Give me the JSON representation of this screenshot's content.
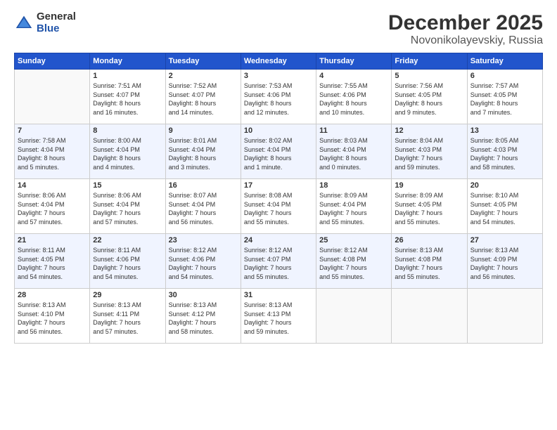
{
  "logo": {
    "general": "General",
    "blue": "Blue"
  },
  "header": {
    "month": "December 2025",
    "location": "Novonikolayevskiy, Russia"
  },
  "weekdays": [
    "Sunday",
    "Monday",
    "Tuesday",
    "Wednesday",
    "Thursday",
    "Friday",
    "Saturday"
  ],
  "weeks": [
    [
      {
        "day": "",
        "info": ""
      },
      {
        "day": "1",
        "info": "Sunrise: 7:51 AM\nSunset: 4:07 PM\nDaylight: 8 hours\nand 16 minutes."
      },
      {
        "day": "2",
        "info": "Sunrise: 7:52 AM\nSunset: 4:07 PM\nDaylight: 8 hours\nand 14 minutes."
      },
      {
        "day": "3",
        "info": "Sunrise: 7:53 AM\nSunset: 4:06 PM\nDaylight: 8 hours\nand 12 minutes."
      },
      {
        "day": "4",
        "info": "Sunrise: 7:55 AM\nSunset: 4:06 PM\nDaylight: 8 hours\nand 10 minutes."
      },
      {
        "day": "5",
        "info": "Sunrise: 7:56 AM\nSunset: 4:05 PM\nDaylight: 8 hours\nand 9 minutes."
      },
      {
        "day": "6",
        "info": "Sunrise: 7:57 AM\nSunset: 4:05 PM\nDaylight: 8 hours\nand 7 minutes."
      }
    ],
    [
      {
        "day": "7",
        "info": "Sunrise: 7:58 AM\nSunset: 4:04 PM\nDaylight: 8 hours\nand 5 minutes."
      },
      {
        "day": "8",
        "info": "Sunrise: 8:00 AM\nSunset: 4:04 PM\nDaylight: 8 hours\nand 4 minutes."
      },
      {
        "day": "9",
        "info": "Sunrise: 8:01 AM\nSunset: 4:04 PM\nDaylight: 8 hours\nand 3 minutes."
      },
      {
        "day": "10",
        "info": "Sunrise: 8:02 AM\nSunset: 4:04 PM\nDaylight: 8 hours\nand 1 minute."
      },
      {
        "day": "11",
        "info": "Sunrise: 8:03 AM\nSunset: 4:04 PM\nDaylight: 8 hours\nand 0 minutes."
      },
      {
        "day": "12",
        "info": "Sunrise: 8:04 AM\nSunset: 4:03 PM\nDaylight: 7 hours\nand 59 minutes."
      },
      {
        "day": "13",
        "info": "Sunrise: 8:05 AM\nSunset: 4:03 PM\nDaylight: 7 hours\nand 58 minutes."
      }
    ],
    [
      {
        "day": "14",
        "info": "Sunrise: 8:06 AM\nSunset: 4:04 PM\nDaylight: 7 hours\nand 57 minutes."
      },
      {
        "day": "15",
        "info": "Sunrise: 8:06 AM\nSunset: 4:04 PM\nDaylight: 7 hours\nand 57 minutes."
      },
      {
        "day": "16",
        "info": "Sunrise: 8:07 AM\nSunset: 4:04 PM\nDaylight: 7 hours\nand 56 minutes."
      },
      {
        "day": "17",
        "info": "Sunrise: 8:08 AM\nSunset: 4:04 PM\nDaylight: 7 hours\nand 55 minutes."
      },
      {
        "day": "18",
        "info": "Sunrise: 8:09 AM\nSunset: 4:04 PM\nDaylight: 7 hours\nand 55 minutes."
      },
      {
        "day": "19",
        "info": "Sunrise: 8:09 AM\nSunset: 4:05 PM\nDaylight: 7 hours\nand 55 minutes."
      },
      {
        "day": "20",
        "info": "Sunrise: 8:10 AM\nSunset: 4:05 PM\nDaylight: 7 hours\nand 54 minutes."
      }
    ],
    [
      {
        "day": "21",
        "info": "Sunrise: 8:11 AM\nSunset: 4:05 PM\nDaylight: 7 hours\nand 54 minutes."
      },
      {
        "day": "22",
        "info": "Sunrise: 8:11 AM\nSunset: 4:06 PM\nDaylight: 7 hours\nand 54 minutes."
      },
      {
        "day": "23",
        "info": "Sunrise: 8:12 AM\nSunset: 4:06 PM\nDaylight: 7 hours\nand 54 minutes."
      },
      {
        "day": "24",
        "info": "Sunrise: 8:12 AM\nSunset: 4:07 PM\nDaylight: 7 hours\nand 55 minutes."
      },
      {
        "day": "25",
        "info": "Sunrise: 8:12 AM\nSunset: 4:08 PM\nDaylight: 7 hours\nand 55 minutes."
      },
      {
        "day": "26",
        "info": "Sunrise: 8:13 AM\nSunset: 4:08 PM\nDaylight: 7 hours\nand 55 minutes."
      },
      {
        "day": "27",
        "info": "Sunrise: 8:13 AM\nSunset: 4:09 PM\nDaylight: 7 hours\nand 56 minutes."
      }
    ],
    [
      {
        "day": "28",
        "info": "Sunrise: 8:13 AM\nSunset: 4:10 PM\nDaylight: 7 hours\nand 56 minutes."
      },
      {
        "day": "29",
        "info": "Sunrise: 8:13 AM\nSunset: 4:11 PM\nDaylight: 7 hours\nand 57 minutes."
      },
      {
        "day": "30",
        "info": "Sunrise: 8:13 AM\nSunset: 4:12 PM\nDaylight: 7 hours\nand 58 minutes."
      },
      {
        "day": "31",
        "info": "Sunrise: 8:13 AM\nSunset: 4:13 PM\nDaylight: 7 hours\nand 59 minutes."
      },
      {
        "day": "",
        "info": ""
      },
      {
        "day": "",
        "info": ""
      },
      {
        "day": "",
        "info": ""
      }
    ]
  ]
}
